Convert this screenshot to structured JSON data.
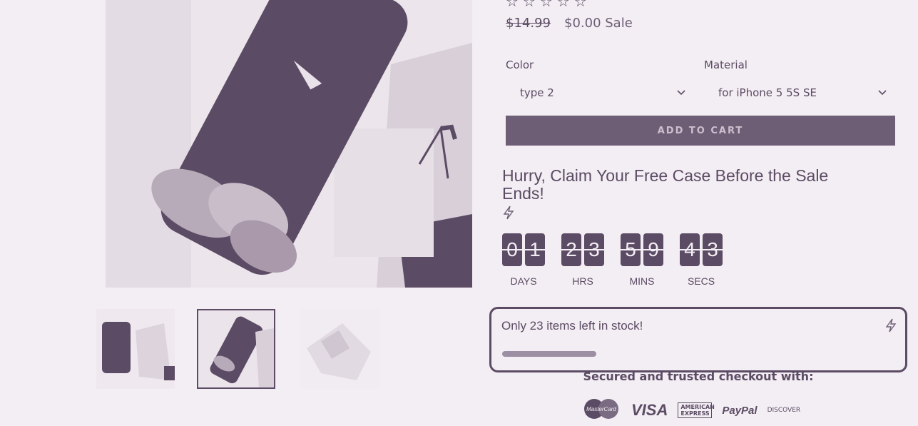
{
  "product": {
    "rating_stars": "☆☆☆☆☆",
    "price_compare": "$14.99",
    "price_sale": "$0.00 Sale"
  },
  "options": {
    "color_label": "Color",
    "color_value": "type 2",
    "material_label": "Material",
    "material_value": "for iPhone 5 5S SE"
  },
  "cart": {
    "add_label": "ADD TO CART"
  },
  "countdown": {
    "heading": "Hurry, Claim Your Free Case Before the Sale Ends!",
    "days": [
      "0",
      "1"
    ],
    "hours": [
      "2",
      "3"
    ],
    "minutes": [
      "5",
      "9"
    ],
    "seconds": [
      "4",
      "3"
    ],
    "days_label": "DAYS",
    "hours_label": "HRS",
    "mins_label": "MINS",
    "secs_label": "SECS"
  },
  "stock": {
    "text": "Only 23 items left in stock!",
    "level_fraction": 0.24
  },
  "checkout": {
    "secured_text": "Secured and trusted checkout with:",
    "payment_methods": [
      "MasterCard",
      "VISA",
      "AMERICAN EXPRESS",
      "PayPal",
      "DISCOVER"
    ]
  },
  "icons": {
    "lightning": "lightning-icon",
    "chevron": "chevron-down-icon"
  },
  "colors": {
    "accent": "#5b4b64",
    "button": "#6d5e75",
    "background": "#f3eef3"
  }
}
